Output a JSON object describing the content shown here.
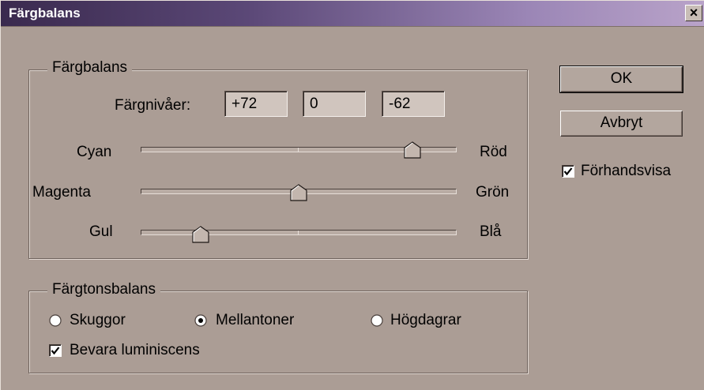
{
  "window": {
    "title": "Färgbalans"
  },
  "color_balance": {
    "legend": "Färgbalans",
    "levels_label": "Färgnivåer:",
    "levels": [
      "+72",
      "0",
      "-62"
    ],
    "sliders": [
      {
        "left": "Cyan",
        "right": "Röd",
        "value": 72
      },
      {
        "left": "Magenta",
        "right": "Grön",
        "value": 0
      },
      {
        "left": "Gul",
        "right": "Blå",
        "value": -62
      }
    ],
    "slider_range": [
      -100,
      100
    ]
  },
  "tone_balance": {
    "legend": "Färgtonsbalans",
    "options": [
      "Skuggor",
      "Mellantoner",
      "Högdagrar"
    ],
    "selected": "Mellantoner",
    "preserve_luminosity": {
      "label": "Bevara luminiscens",
      "checked": true
    }
  },
  "buttons": {
    "ok": "OK",
    "cancel": "Avbryt"
  },
  "preview": {
    "label": "Förhandsvisa",
    "checked": true
  }
}
